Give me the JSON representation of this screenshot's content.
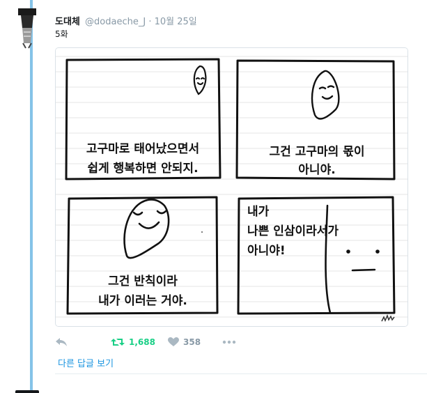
{
  "tweet": {
    "display_name": "도대체",
    "username": "@dodaeche_J",
    "separator": "·",
    "timestamp": "10월 25일",
    "text": "5화"
  },
  "comic": {
    "panel1_line1": "고구마로 태어났으면서",
    "panel1_line2": "쉽게 행복하면 안되지.",
    "panel2_line1": "그건 고구마의 몫이",
    "panel2_line2": "아니야.",
    "panel3_line1": "그건 반칙이라",
    "panel3_line2": "내가 이러는 거야.",
    "panel4_line1": "내가",
    "panel4_line2": "나쁜 인삼이라서가",
    "panel4_line3": "아니야!"
  },
  "actions": {
    "retweet_count": "1,688",
    "like_count": "358"
  },
  "more_replies": "다른 답글 보기",
  "colors": {
    "thread_line": "#85c3e8",
    "retweet_green": "#19cf86",
    "link_blue": "#1b95e0",
    "muted_gray": "#8899a6"
  }
}
